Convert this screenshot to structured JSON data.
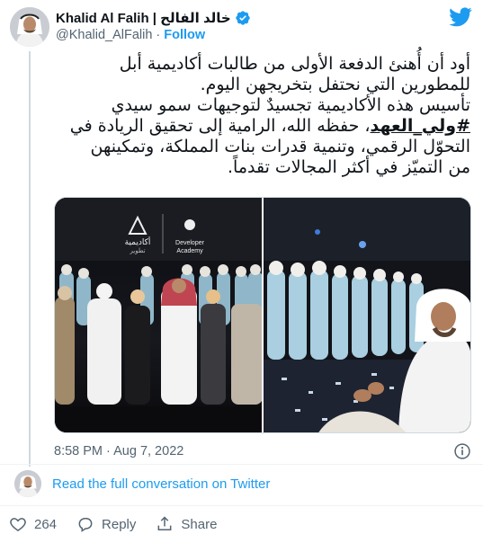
{
  "author": {
    "name": "Khalid Al Falih | خالد الفالح",
    "handle": "@Khalid_AlFalih",
    "separator": "·",
    "follow_label": "Follow"
  },
  "tweet": {
    "lines": [
      "أود أن أُهنئ الدفعة الأولى من طالبات أكاديمية أبل",
      "للمطورين التي نحتفل بتخريجهن اليوم.",
      "تأسيس هذه الأكاديمية تجسيدٌ لتوجيهات سمو سيدي"
    ],
    "hashtag": "#ولي_العهد",
    "line4_rest": "، حفظه الله، الرامية إلى تحقيق الريادة في",
    "lines_after": [
      "التحوّل الرقمي، وتنمية قدرات بنات المملكة، وتمكينهن",
      "من التميّز في أكثر المجالات تقدماً."
    ]
  },
  "media": {
    "left_sign_ar": "أكاديمية",
    "left_sign_ar2": "تطوير",
    "left_sign_en1": "Developer",
    "left_sign_en2": "Academy"
  },
  "meta": {
    "time": "8:58 PM",
    "dot": "·",
    "date": "Aug 7, 2022"
  },
  "conversation": {
    "link_label": "Read the full conversation on Twitter"
  },
  "actions": {
    "likes": "264",
    "reply_label": "Reply",
    "share_label": "Share"
  },
  "colors": {
    "accent": "#1d9bf0",
    "text": "#0f1419",
    "muted": "#536471"
  }
}
